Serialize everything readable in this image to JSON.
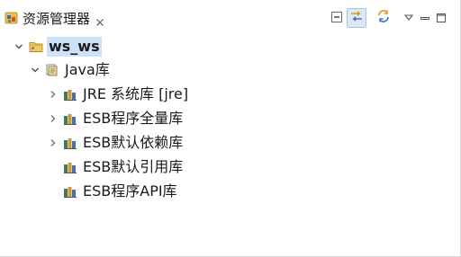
{
  "view": {
    "title": "资源管理器",
    "menu_glyph": "▽"
  },
  "tree": {
    "project": {
      "label": "ws_ws",
      "expanded": true,
      "selected": true
    },
    "container": {
      "label": "Java库",
      "expanded": true
    },
    "libraries": [
      {
        "label": "JRE 系统库 [jre]",
        "expandable": true
      },
      {
        "label": "ESB程序全量库",
        "expandable": true
      },
      {
        "label": "ESB默认依赖库",
        "expandable": true
      },
      {
        "label": "ESB默认引用库",
        "expandable": false
      },
      {
        "label": "ESB程序API库",
        "expandable": false
      }
    ]
  },
  "colors": {
    "selection": "#cde2f6",
    "folder": "#e8b84a",
    "library_book": "#3f7f4f"
  },
  "icons": {
    "tab": "package-explorer-icon",
    "close": "close-icon",
    "collapse_all": "collapse-all-icon",
    "link_with_editor": "link-with-editor-icon",
    "sync": "sync-icon",
    "view_menu": "view-menu-icon",
    "minimize": "minimize-icon",
    "maximize": "maximize-icon",
    "project": "project-folder-icon",
    "library_container": "library-container-icon",
    "library": "library-jar-icon",
    "expanded": "chevron-down-icon",
    "collapsed": "chevron-right-icon"
  }
}
